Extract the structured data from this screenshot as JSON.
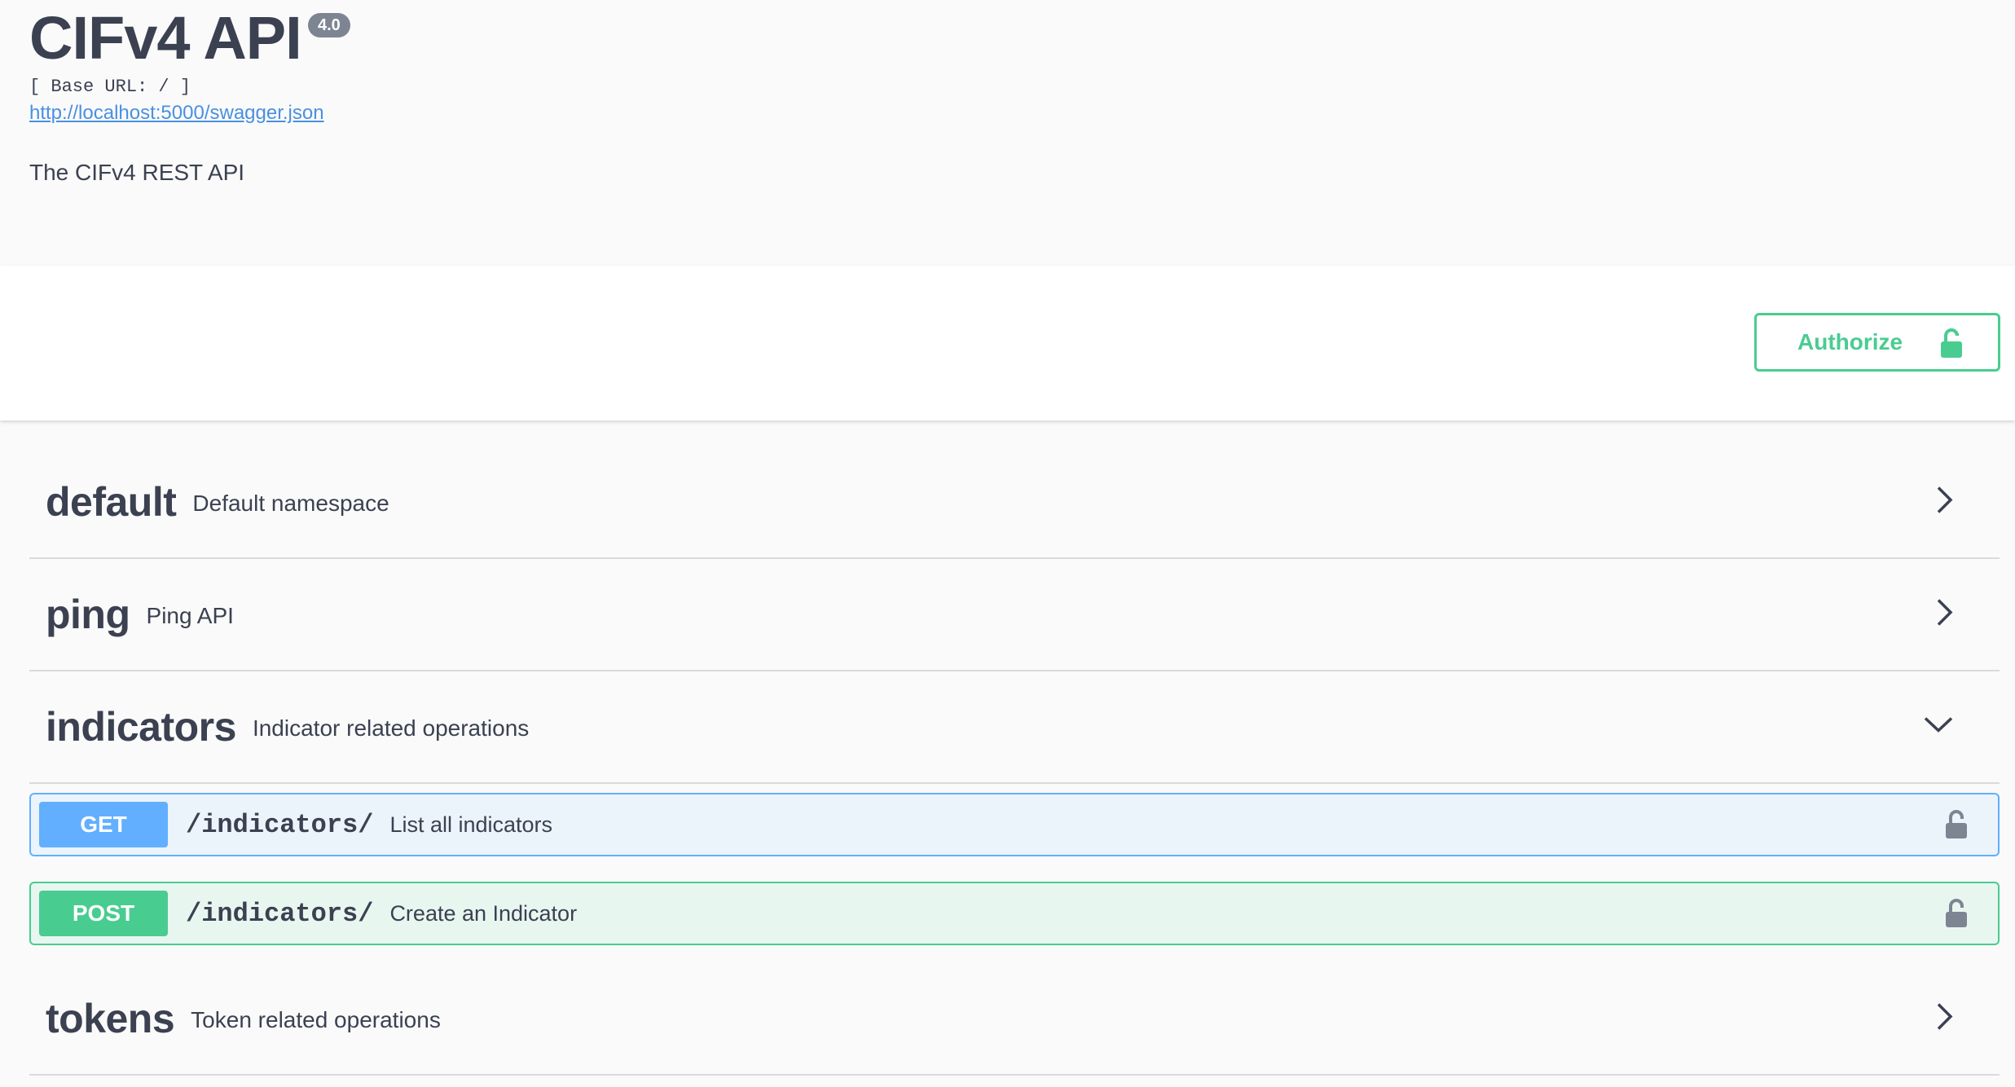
{
  "info": {
    "title": "CIFv4 API",
    "version": "4.0",
    "base_url": "[ Base URL: / ]",
    "swagger_link": "http://localhost:5000/swagger.json",
    "description": "The CIFv4 REST API"
  },
  "auth": {
    "authorize_label": "Authorize",
    "lock_icon": "lock-icon"
  },
  "colors": {
    "get": "#61affe",
    "post": "#49cc90",
    "text": "#3b4151",
    "link": "#4990e2"
  },
  "tags": [
    {
      "name": "default",
      "description": "Default namespace",
      "expanded": false
    },
    {
      "name": "ping",
      "description": "Ping API",
      "expanded": false
    },
    {
      "name": "indicators",
      "description": "Indicator related operations",
      "expanded": true,
      "operations": [
        {
          "method": "GET",
          "path": "/indicators/",
          "summary": "List all indicators"
        },
        {
          "method": "POST",
          "path": "/indicators/",
          "summary": "Create an Indicator"
        }
      ]
    },
    {
      "name": "tokens",
      "description": "Token related operations",
      "expanded": false
    }
  ]
}
